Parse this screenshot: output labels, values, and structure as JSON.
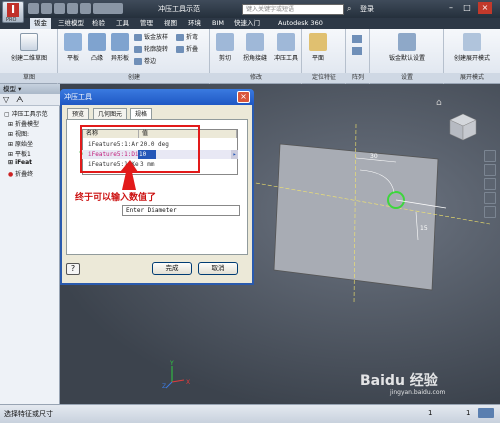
{
  "app": {
    "title": "冲压工具示范",
    "search_placeholder": "键入关键字或短语",
    "login": "登录",
    "logo_letter": "I",
    "logo_sub": "PRO"
  },
  "menu": {
    "tabs": [
      "钣金",
      "三维模型",
      "检验",
      "工具",
      "管理",
      "视图",
      "环境",
      "BIM",
      "快速入门",
      "Autodesk 360"
    ],
    "active": "钣金"
  },
  "ribbon": {
    "sketch": {
      "create_btn": "创建二维草图",
      "label": "草图"
    },
    "create": {
      "buttons": [
        "平板",
        "凸缘",
        "异形板"
      ],
      "small": [
        "钣金放样",
        "轮廓旋转",
        "卷边",
        "折弯",
        "折叠"
      ],
      "label": "创建"
    },
    "modify": {
      "buttons": [
        "剪切",
        "拐角接缝",
        "冲压工具"
      ],
      "label": "修改"
    },
    "position": {
      "button": "平面",
      "label": "定位特征"
    },
    "array": {
      "label": "阵列"
    },
    "settings": {
      "button": "钣金默认设置",
      "label": "设置"
    },
    "flat": {
      "button": "创建展开模式",
      "label": "展开模式"
    }
  },
  "left_panel": {
    "header": "模型 ▾",
    "tree": [
      "冲压工具示范",
      "折叠模型",
      "视图:",
      "原始坐",
      "平板1",
      "iFeat",
      "折叠终"
    ]
  },
  "dialog": {
    "title": "冲压工具",
    "close": "×",
    "tabs": [
      "预览",
      "几何图元",
      "规格"
    ],
    "active_tab": "规格",
    "grid_header": [
      "名称",
      "值"
    ],
    "rows": [
      {
        "name": "iFeature5:1:Ar",
        "value": "20.0 deg"
      },
      {
        "name": "iFeature5:1:Di",
        "value": "10 mm"
      },
      {
        "name": "iFeature5:1:Ke",
        "value": "3 mm"
      }
    ],
    "hint": "Enter Diameter",
    "annotation": "终于可以输入数值了",
    "help": "?",
    "ok": "完成",
    "cancel": "取消"
  },
  "viewport": {
    "dim_top": "30",
    "dim_side": "15",
    "axis_x": "X",
    "axis_y": "Y",
    "axis_z": "Z"
  },
  "status": {
    "text": "选择特征或尺寸",
    "right_num1": "1",
    "right_num2": "1"
  },
  "watermark": {
    "text": "Baidu 经验",
    "url": "jingyan.baidu.com"
  },
  "colors": {
    "dialog_blue": "#1f58c4",
    "annotation_red": "#cc1111",
    "hole_green": "#3dd63d"
  }
}
